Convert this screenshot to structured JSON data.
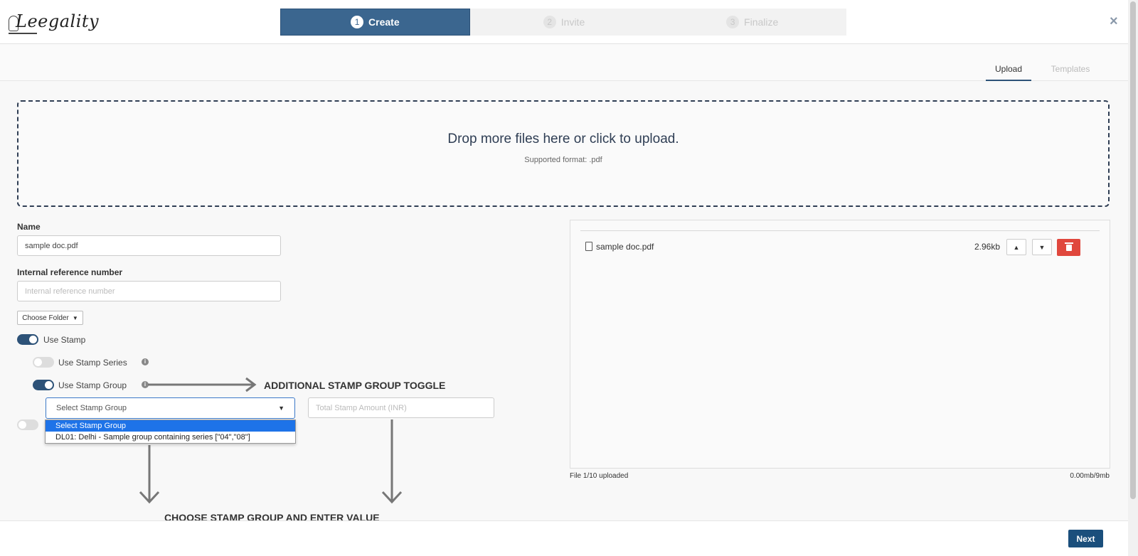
{
  "logo": {
    "text": "Leegality"
  },
  "steps": [
    {
      "num": "1",
      "label": "Create",
      "active": true
    },
    {
      "num": "2",
      "label": "Invite",
      "active": false
    },
    {
      "num": "3",
      "label": "Finalize",
      "active": false
    }
  ],
  "close_icon": "×",
  "tabs": {
    "upload": "Upload",
    "templates": "Templates"
  },
  "dropzone": {
    "title": "Drop more files here or click to upload.",
    "subtitle": "Supported format: .pdf"
  },
  "form": {
    "name_label": "Name",
    "name_value": "sample doc.pdf",
    "ref_label": "Internal reference number",
    "ref_placeholder": "Internal reference number",
    "folder_label": "Choose Folder",
    "use_stamp_label": "Use Stamp",
    "use_stamp_series_label": "Use Stamp Series",
    "use_stamp_group_label": "Use Stamp Group",
    "stamp_group_select": "Select Stamp Group",
    "stamp_group_options": [
      "Select Stamp Group",
      "DL01: Delhi - Sample group containing series [\"04\",\"08\"]"
    ],
    "total_amount_placeholder": "Total Stamp Amount (INR)"
  },
  "annotations": {
    "toggle": "ADDITIONAL STAMP GROUP TOGGLE",
    "choose": "CHOOSE STAMP GROUP AND ENTER VALUE"
  },
  "file": {
    "name": "sample doc.pdf",
    "size": "2.96kb"
  },
  "upload_status": {
    "count": "File 1/10 uploaded",
    "size": "0.00mb/9mb"
  },
  "footer": {
    "next_label": "Next"
  },
  "colors": {
    "primary": "#3b668f",
    "dark": "#2d5278",
    "delete": "#e0473d",
    "select_highlight": "#1e73e8"
  }
}
